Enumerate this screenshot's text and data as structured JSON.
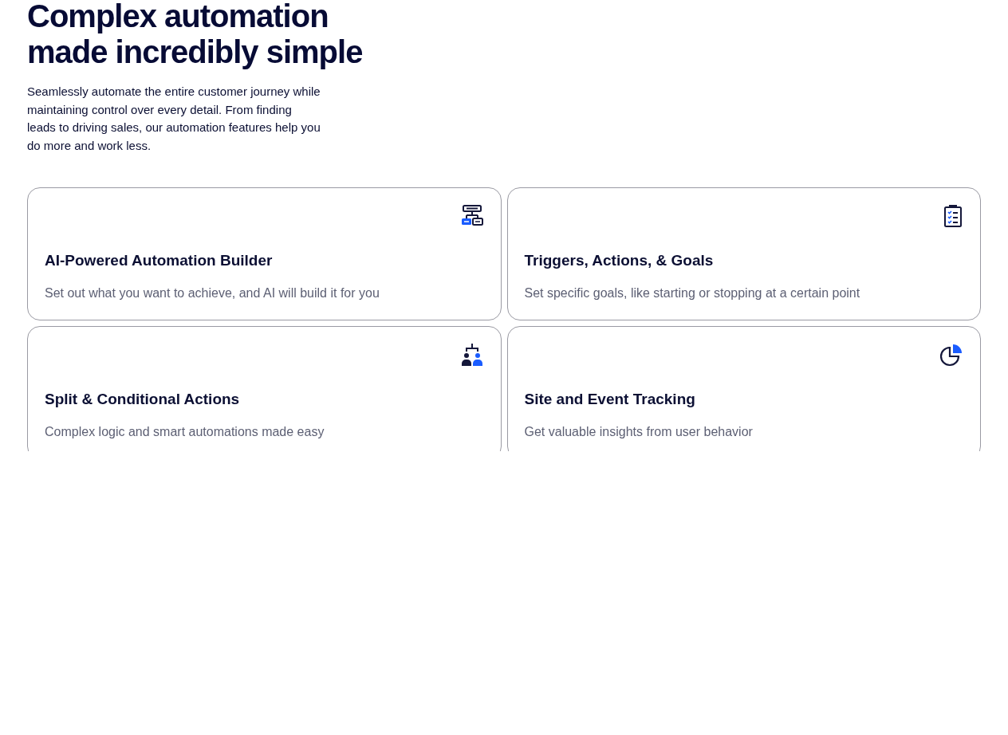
{
  "heading": [
    "Complex automation",
    "made incredibly simple"
  ],
  "intro": "Seamlessly automate the entire customer journey while maintaining control over every detail. From finding leads to driving sales, our automation features help you do more and work less.",
  "features": [
    {
      "title": "AI-Powered Automation Builder",
      "description": "Set out what you want to achieve, and AI will build it for you"
    },
    {
      "title": "Triggers, Actions, & Goals",
      "description": "Set specific goals, like starting or stopping at a certain point"
    },
    {
      "title": "Split & Conditional Actions",
      "description": "Complex logic and smart automations made easy"
    },
    {
      "title": "Site and Event Tracking",
      "description": "Get valuable insights from user behavior"
    }
  ]
}
